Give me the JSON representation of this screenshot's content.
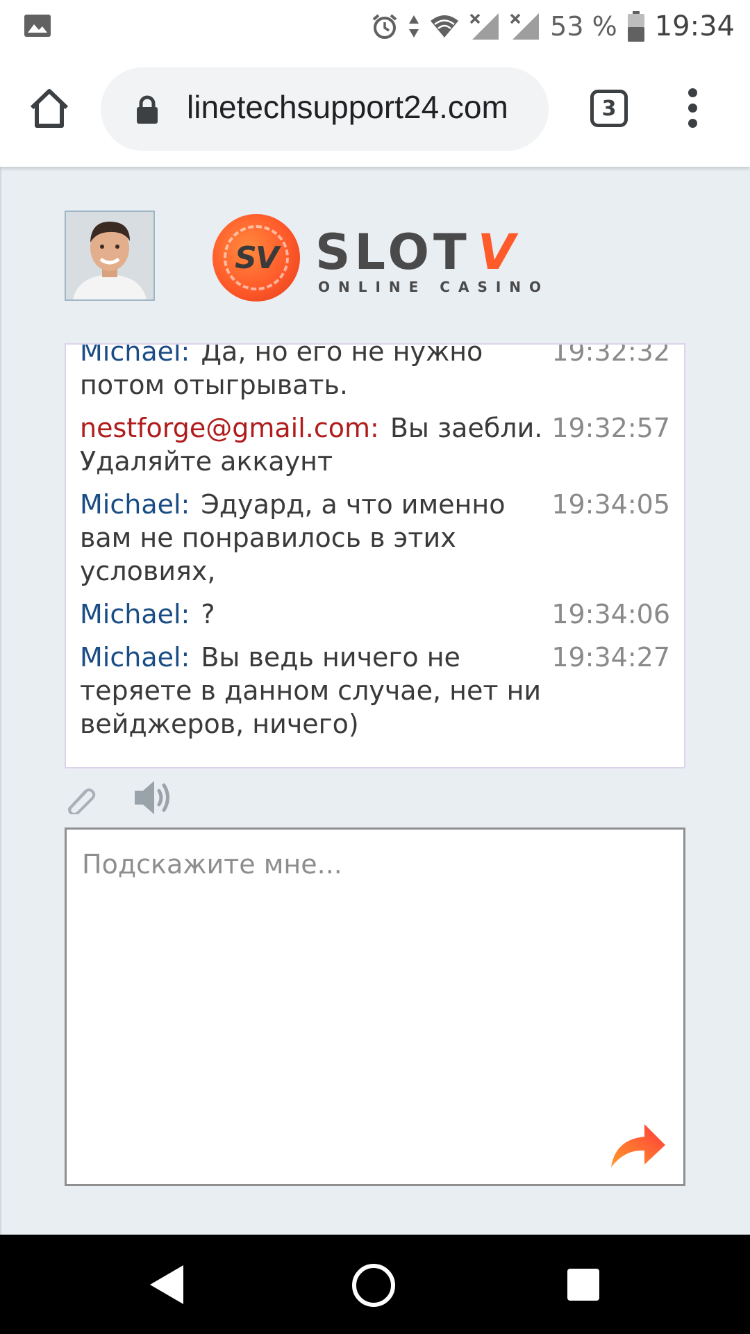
{
  "status_bar": {
    "battery_percent": "53 %",
    "time": "19:34"
  },
  "browser": {
    "url": "linetechsupport24.com",
    "tab_count": "3"
  },
  "brand": {
    "logo_mark": "SV",
    "logo_word": "SLOT",
    "logo_word_accent": "V",
    "logo_tagline": "ONLINE CASINO",
    "accent_color": "#ff5a2a"
  },
  "chat": {
    "messages": [
      {
        "author": "Michael:",
        "text": "Да, но его не нужно потом отыгрывать.",
        "time": "19:32:32"
      },
      {
        "author": "nestforge@gmail.com:",
        "text": "Вы заебли. Удаляйте аккаунт",
        "time": "19:32:57"
      },
      {
        "author": "Michael:",
        "text": "Эдуард, а что именно вам не понравилось в этих условиях,",
        "time": "19:34:05"
      },
      {
        "author": "Michael:",
        "text": "?",
        "time": "19:34:06"
      },
      {
        "author": "Michael:",
        "text": "Вы ведь ничего не теряете в данном случае, нет ни вейджеров, ничего)",
        "time": "19:34:27"
      }
    ],
    "input_placeholder": "Подскажите мне...",
    "operator_color": "#1a4c85",
    "user_color": "#b01c1c"
  }
}
